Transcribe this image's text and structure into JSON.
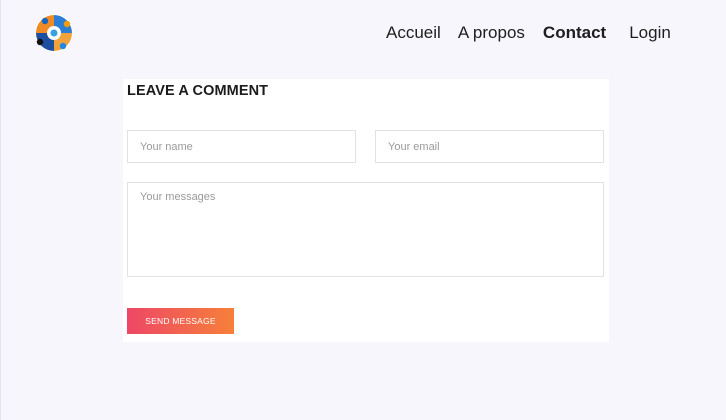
{
  "nav": {
    "items": [
      {
        "label": "Accueil",
        "active": false
      },
      {
        "label": "A propos",
        "active": false
      },
      {
        "label": "Contact",
        "active": true
      },
      {
        "label": "Login",
        "active": false
      }
    ]
  },
  "logo": {
    "icon": "circular-people-logo-icon"
  },
  "comment_form": {
    "title": "LEAVE A COMMENT",
    "name_placeholder": "Your name",
    "email_placeholder": "Your email",
    "message_placeholder": "Your messages",
    "submit_label": "SEND MESSAGE"
  },
  "colors": {
    "page_background": "#f7f6fc",
    "button_gradient_start": "#ee4766",
    "button_gradient_end": "#f6803a"
  }
}
